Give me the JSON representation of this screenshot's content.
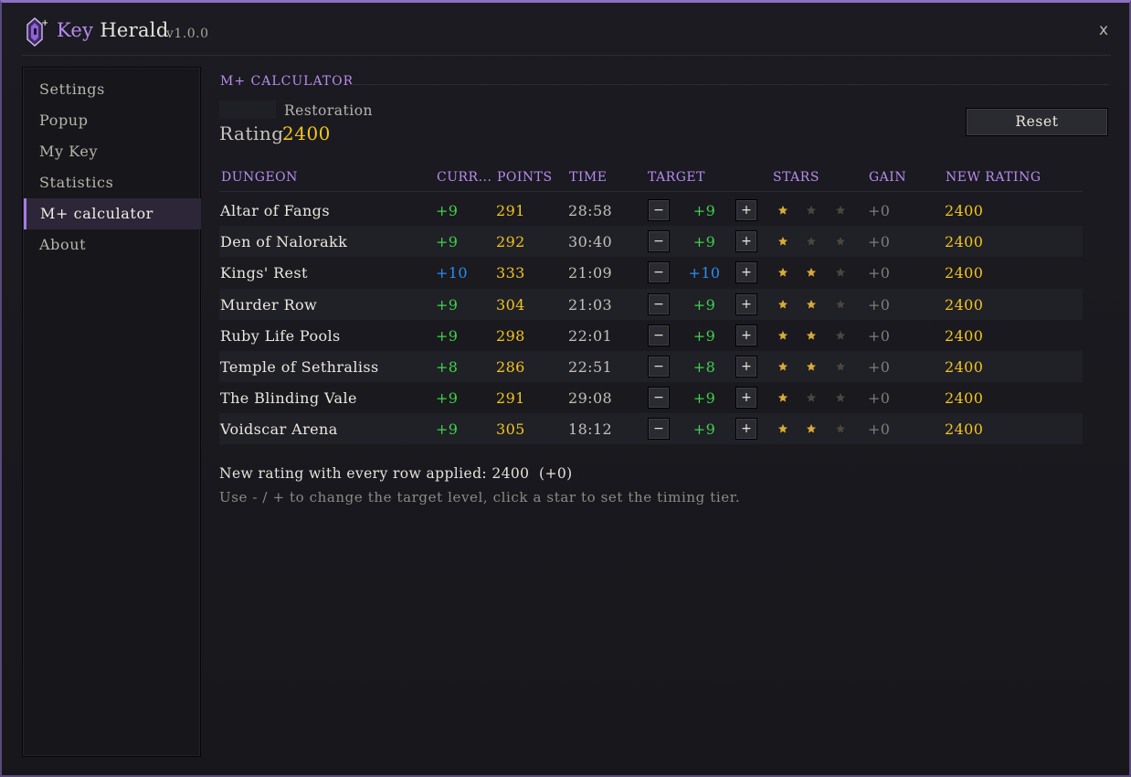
{
  "app": {
    "title_key": "Key",
    "title_rest": "Herald",
    "version": "v1.0.0",
    "close_label": "x"
  },
  "sidebar": {
    "items": [
      {
        "label": "Settings",
        "active": false
      },
      {
        "label": "Popup",
        "active": false
      },
      {
        "label": "My Key",
        "active": false
      },
      {
        "label": "Statistics",
        "active": false
      },
      {
        "label": "M+ calculator",
        "active": true
      },
      {
        "label": "About",
        "active": false
      }
    ]
  },
  "calculator": {
    "section_title": "M+ CALCULATOR",
    "spec": "Restoration",
    "rating_label": "Rating",
    "rating_value": "2400",
    "reset_label": "Reset",
    "columns": {
      "dungeon": "DUNGEON",
      "curr": "CURR...",
      "points": "POINTS",
      "time": "TIME",
      "target": "TARGET",
      "stars": "STARS",
      "gain": "GAIN",
      "new_rating": "NEW RATING"
    },
    "stepper": {
      "minus": "−",
      "plus": "+"
    },
    "rows": [
      {
        "dungeon": "Altar of Fangs",
        "curr": "+9",
        "points": "291",
        "time": "28:58",
        "target": "+9",
        "stars": 1,
        "gain": "+0",
        "new_rating": "2400",
        "level_color": "green"
      },
      {
        "dungeon": "Den of Nalorakk",
        "curr": "+9",
        "points": "292",
        "time": "30:40",
        "target": "+9",
        "stars": 1,
        "gain": "+0",
        "new_rating": "2400",
        "level_color": "green"
      },
      {
        "dungeon": "Kings' Rest",
        "curr": "+10",
        "points": "333",
        "time": "21:09",
        "target": "+10",
        "stars": 2,
        "gain": "+0",
        "new_rating": "2400",
        "level_color": "blue"
      },
      {
        "dungeon": "Murder Row",
        "curr": "+9",
        "points": "304",
        "time": "21:03",
        "target": "+9",
        "stars": 2,
        "gain": "+0",
        "new_rating": "2400",
        "level_color": "green"
      },
      {
        "dungeon": "Ruby Life Pools",
        "curr": "+9",
        "points": "298",
        "time": "22:01",
        "target": "+9",
        "stars": 2,
        "gain": "+0",
        "new_rating": "2400",
        "level_color": "green"
      },
      {
        "dungeon": "Temple of Sethraliss",
        "curr": "+8",
        "points": "286",
        "time": "22:51",
        "target": "+8",
        "stars": 2,
        "gain": "+0",
        "new_rating": "2400",
        "level_color": "green"
      },
      {
        "dungeon": "The Blinding Vale",
        "curr": "+9",
        "points": "291",
        "time": "29:08",
        "target": "+9",
        "stars": 1,
        "gain": "+0",
        "new_rating": "2400",
        "level_color": "green"
      },
      {
        "dungeon": "Voidscar Arena",
        "curr": "+9",
        "points": "305",
        "time": "18:12",
        "target": "+9",
        "stars": 2,
        "gain": "+0",
        "new_rating": "2400",
        "level_color": "green"
      }
    ],
    "summary": "New rating with every row applied: 2400  (+0)",
    "hint": "Use - / + to change the target level, click a star to set the timing tier."
  },
  "colors": {
    "accent": "#b98bf0",
    "gold": "#f2c41e",
    "green": "#3fd34a",
    "blue": "#2c8df2",
    "star_on": "#d9a93a",
    "star_off": "#4a4740"
  }
}
